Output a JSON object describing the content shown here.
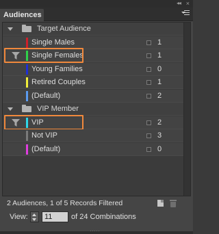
{
  "panel": {
    "tab_title": "Audiences",
    "tab_close": "×",
    "collapse_glyph": "◂◂",
    "close_glyph": "×"
  },
  "groups": [
    {
      "name": "Target Audience",
      "expanded": true,
      "items": [
        {
          "label": "Single Males",
          "color": "#d0202a",
          "count": "1",
          "filtered": false
        },
        {
          "label": "Single Females",
          "color": "#2fd14a",
          "count": "1",
          "filtered": true
        },
        {
          "label": "Young Families",
          "color": "#1f2fd6",
          "count": "0",
          "filtered": false
        },
        {
          "label": "Retired Couples",
          "color": "#f2ee3a",
          "count": "1",
          "filtered": false
        },
        {
          "label": "(Default)",
          "color": "#5b9bf0",
          "count": "2",
          "filtered": false
        }
      ]
    },
    {
      "name": "VIP Member",
      "expanded": true,
      "items": [
        {
          "label": "VIP",
          "color": "#2fd8e8",
          "count": "2",
          "filtered": true
        },
        {
          "label": "Not VIP",
          "color": "#7a7a7a",
          "count": "3",
          "filtered": false
        },
        {
          "label": "(Default)",
          "color": "#e03ee0",
          "count": "0",
          "filtered": false
        }
      ]
    }
  ],
  "status": {
    "text": "2  Audiences, 1 of 5 Records Filtered"
  },
  "view": {
    "label": "View:",
    "value": "11",
    "suffix": "of 24 Combinations"
  },
  "colors": {
    "highlight": "#f1893c",
    "panel_bg": "#454545"
  }
}
